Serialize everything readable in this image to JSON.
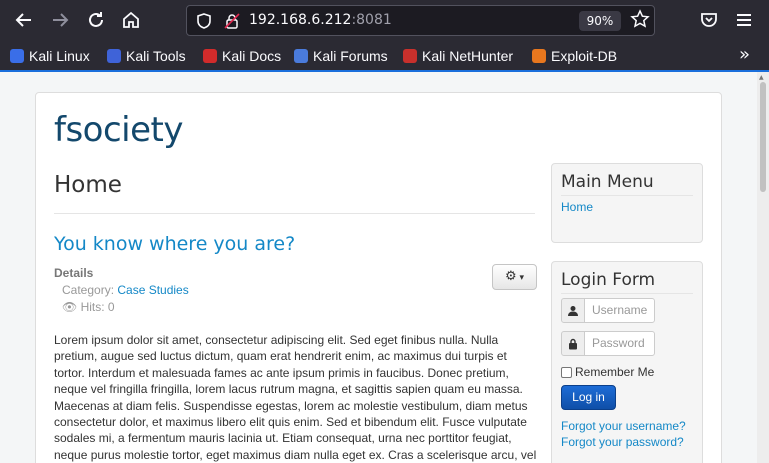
{
  "browser": {
    "url_host": "192.168.6.212",
    "url_port": ":8081",
    "zoom": "90%",
    "icons": [
      "back-icon",
      "forward-icon",
      "reload-icon",
      "home-icon",
      "shield-icon",
      "lock-icon",
      "star-icon",
      "pocket-icon",
      "menu-icon"
    ],
    "bookmarks": [
      "Kali Linux",
      "Kali Tools",
      "Kali Docs",
      "Kali Forums",
      "Kali NetHunter",
      "Exploit-DB"
    ],
    "accent_color": "#1a6fdc"
  },
  "site": {
    "title": "fsociety",
    "page_heading": "Home"
  },
  "article": {
    "title": "You know where you are?",
    "details_label": "Details",
    "category_prefix": "Category: ",
    "category": "Case Studies",
    "hits": "Hits: 0",
    "body": "Lorem ipsum dolor sit amet, consectetur adipiscing elit. Sed eget finibus nulla. Nulla pretium, augue sed luctus dictum, quam erat hendrerit enim, ac maximus dui turpis et tortor. Interdum et malesuada fames ac ante ipsum primis in faucibus. Donec pretium, neque vel fringilla fringilla, lorem lacus rutrum magna, et sagittis sapien quam eu massa. Maecenas at diam felis. Suspendisse egestas, lorem ac molestie vestibulum, diam metus consectetur dolor, et maximus libero elit quis enim. Sed et bibendum elit. Fusce vulputate sodales mi, a fermentum mauris lacinia ut. Etiam consequat, urna nec porttitor feugiat, neque purus molestie tortor, eget maximus diam nulla eget ex. Cras a scelerisque arcu, vel consectetur sem. Morbi"
  },
  "main_menu": {
    "title": "Main Menu",
    "items": [
      "Home"
    ]
  },
  "login_form": {
    "title": "Login Form",
    "username_placeholder": "Username",
    "password_placeholder": "Password",
    "remember_label": "Remember Me",
    "login_button": "Log in",
    "forgot_username": "Forgot your username?",
    "forgot_password": "Forgot your password?"
  }
}
